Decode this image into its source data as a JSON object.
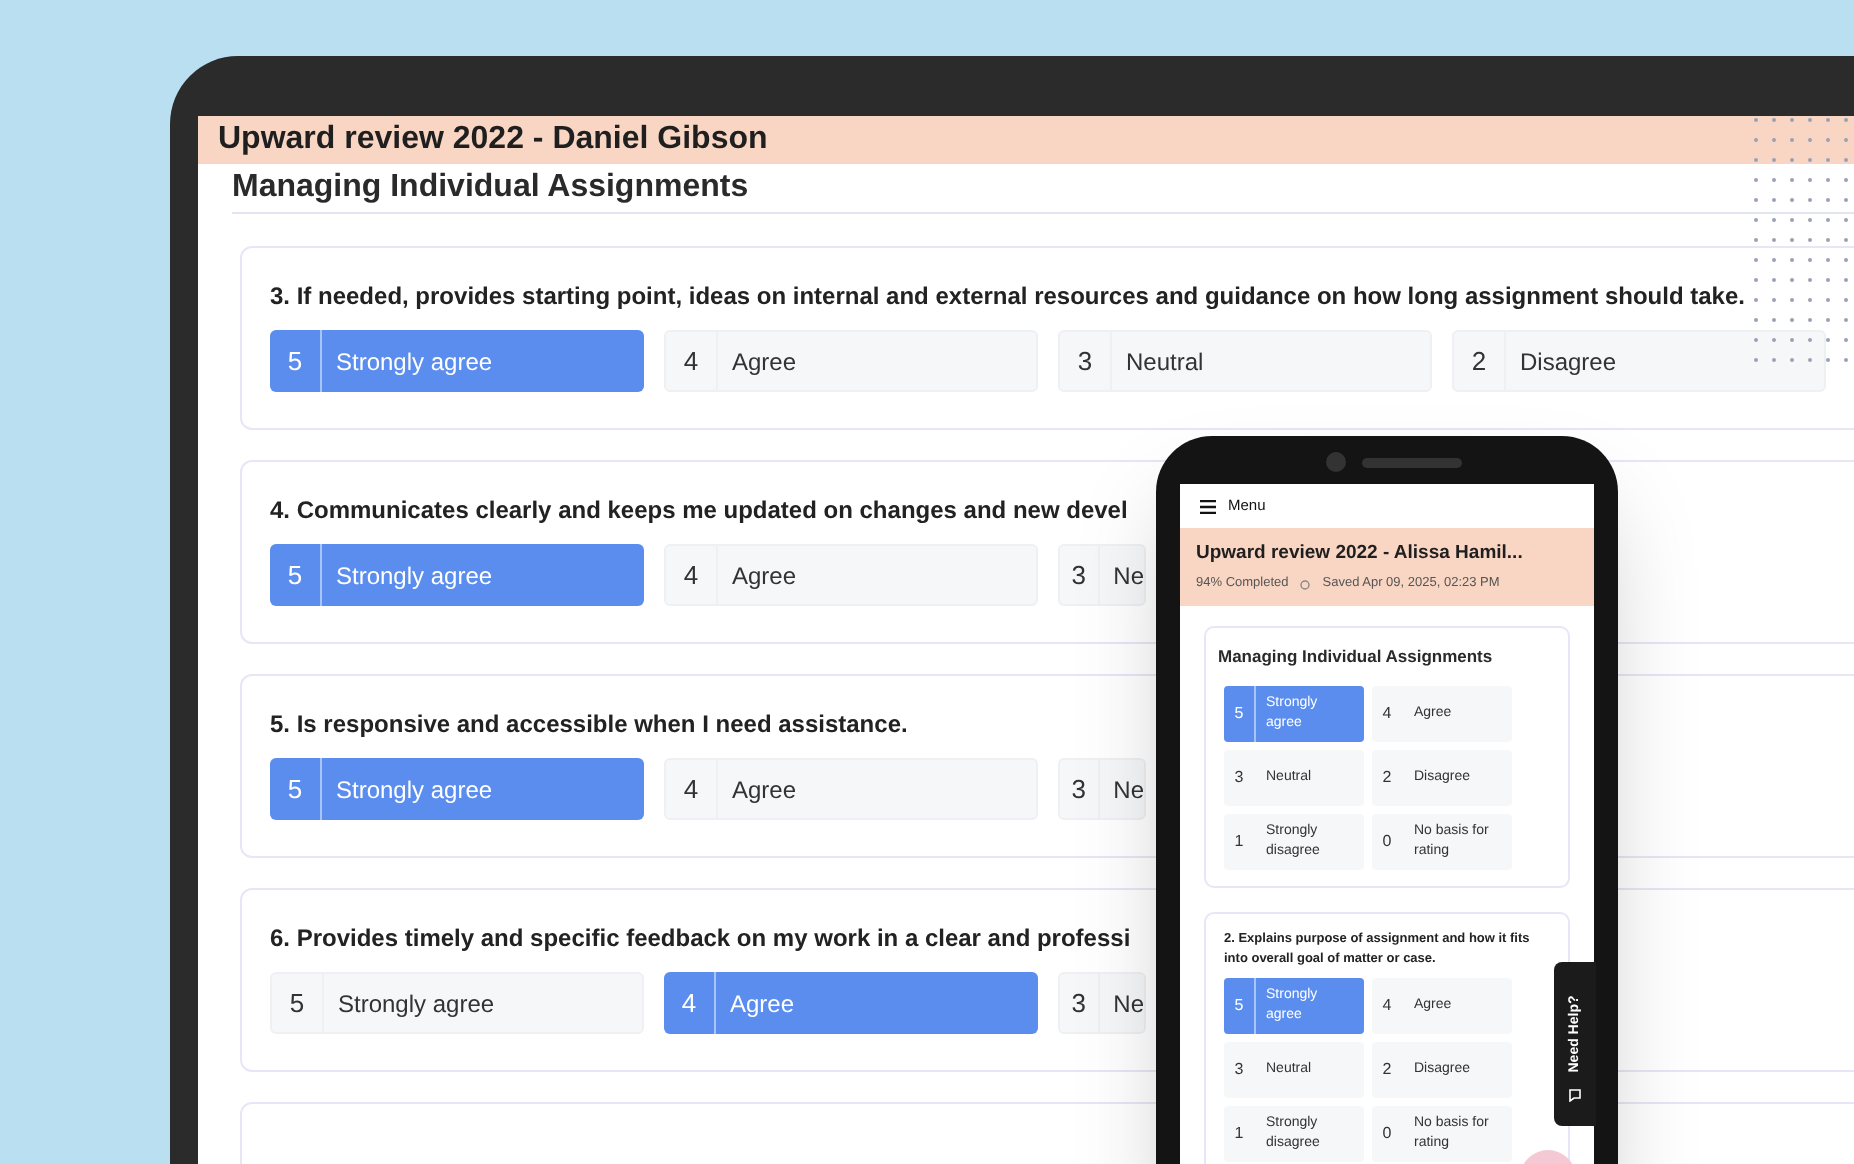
{
  "laptop": {
    "title": "Upward review 2022 - Daniel Gibson",
    "section": "Managing Individual Assignments",
    "questions": [
      {
        "text": "3. If needed, provides starting point, ideas on internal and external resources and guidance on how long assignment should take.",
        "options": [
          {
            "number": "5",
            "label": "Strongly agree",
            "selected": true
          },
          {
            "number": "4",
            "label": "Agree",
            "selected": false
          },
          {
            "number": "3",
            "label": "Neutral",
            "selected": false
          },
          {
            "number": "2",
            "label": "Disagree",
            "selected": false
          }
        ]
      },
      {
        "text": "4. Communicates clearly and keeps me updated on changes and new devel",
        "options": [
          {
            "number": "5",
            "label": "Strongly agree",
            "selected": true
          },
          {
            "number": "4",
            "label": "Agree",
            "selected": false
          },
          {
            "number": "3",
            "label": "Ne",
            "selected": false
          }
        ]
      },
      {
        "text": "5. Is responsive and accessible when I need assistance.",
        "options": [
          {
            "number": "5",
            "label": "Strongly agree",
            "selected": true
          },
          {
            "number": "4",
            "label": "Agree",
            "selected": false
          },
          {
            "number": "3",
            "label": "Ne",
            "selected": false
          }
        ]
      },
      {
        "text": "6. Provides timely and specific feedback on my work in a clear and professi",
        "options": [
          {
            "number": "5",
            "label": "Strongly agree",
            "selected": false
          },
          {
            "number": "4",
            "label": "Agree",
            "selected": true
          },
          {
            "number": "3",
            "label": "Ne",
            "selected": false
          }
        ]
      }
    ]
  },
  "phone": {
    "menu_label": "Menu",
    "title": "Upward review 2022 - Alissa Hamil...",
    "progress": "94% Completed",
    "saved": "Saved Apr 09, 2025, 02:23 PM",
    "section": "Managing Individual Assignments",
    "questions": [
      {
        "options": [
          {
            "number": "5",
            "label": "Strongly agree",
            "selected": true
          },
          {
            "number": "4",
            "label": "Agree",
            "selected": false
          },
          {
            "number": "3",
            "label": "Neutral",
            "selected": false
          },
          {
            "number": "2",
            "label": "Disagree",
            "selected": false
          },
          {
            "number": "1",
            "label": "Strongly disagree",
            "selected": false
          },
          {
            "number": "0",
            "label": "No basis for rating",
            "selected": false
          }
        ]
      },
      {
        "text": "2. Explains purpose of assignment and how it fits into overall goal of matter or case.",
        "options": [
          {
            "number": "5",
            "label": "Strongly agree",
            "selected": true
          },
          {
            "number": "4",
            "label": "Agree",
            "selected": false
          },
          {
            "number": "3",
            "label": "Neutral",
            "selected": false
          },
          {
            "number": "2",
            "label": "Disagree",
            "selected": false
          },
          {
            "number": "1",
            "label": "Strongly disagree",
            "selected": false
          },
          {
            "number": "0",
            "label": "No basis for rating",
            "selected": false
          }
        ]
      }
    ],
    "help_label": "Need Help?"
  }
}
